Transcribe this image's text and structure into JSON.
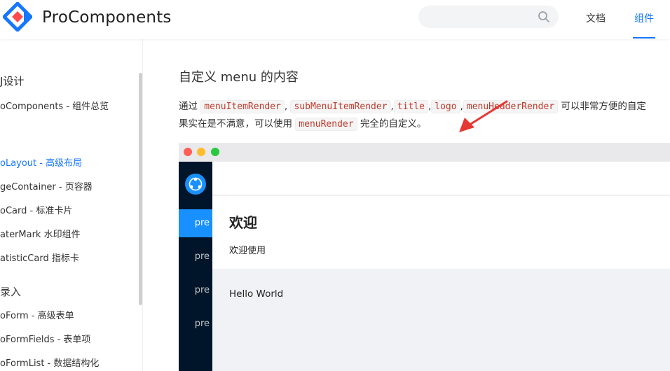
{
  "header": {
    "brand": "ProComponents",
    "search_placeholder": "",
    "nav": [
      {
        "label": "文档",
        "active": false
      },
      {
        "label": "组件",
        "active": true
      }
    ]
  },
  "sidebar": {
    "groups": [
      "J设计",
      "",
      "录入"
    ],
    "items": [
      {
        "label": "oComponents - 组件总览",
        "active": false
      },
      {
        "label": "oLayout - 高级布局",
        "active": true
      },
      {
        "label": "geContainer - 页容器",
        "active": false
      },
      {
        "label": "oCard - 标准卡片",
        "active": false
      },
      {
        "label": "aterMark 水印组件",
        "active": false
      },
      {
        "label": "atisticCard 指标卡",
        "active": false
      },
      {
        "label": "oForm - 高级表单",
        "active": false
      },
      {
        "label": "oFormFields - 表单项",
        "active": false
      },
      {
        "label": "oFormList - 数据结构化",
        "active": false
      }
    ]
  },
  "content": {
    "title": "自定义 menu 的内容",
    "desc_lead": "通过",
    "codes": [
      "menuItemRender",
      "subMenuItemRender",
      "title",
      "logo",
      "menuHeaderRender"
    ],
    "sep1": ",",
    "sep": ",",
    "desc_tail_1": "可以非常方便的自定",
    "desc_line2_lead": "果实在是不满意，可以使用",
    "code_render": "menuRender",
    "desc_line2_tail": "完全的自定义。"
  },
  "demo": {
    "menu_items": [
      "pre",
      "pre",
      "pre",
      "pre"
    ],
    "page_title": "欢迎",
    "page_subtitle": "欢迎使用",
    "body_text": "Hello World"
  },
  "colors": {
    "accent": "#1677ff",
    "code": "#c0392b",
    "sider": "#001529",
    "menu_selected": "#1890ff",
    "arrow": "#e53935"
  }
}
